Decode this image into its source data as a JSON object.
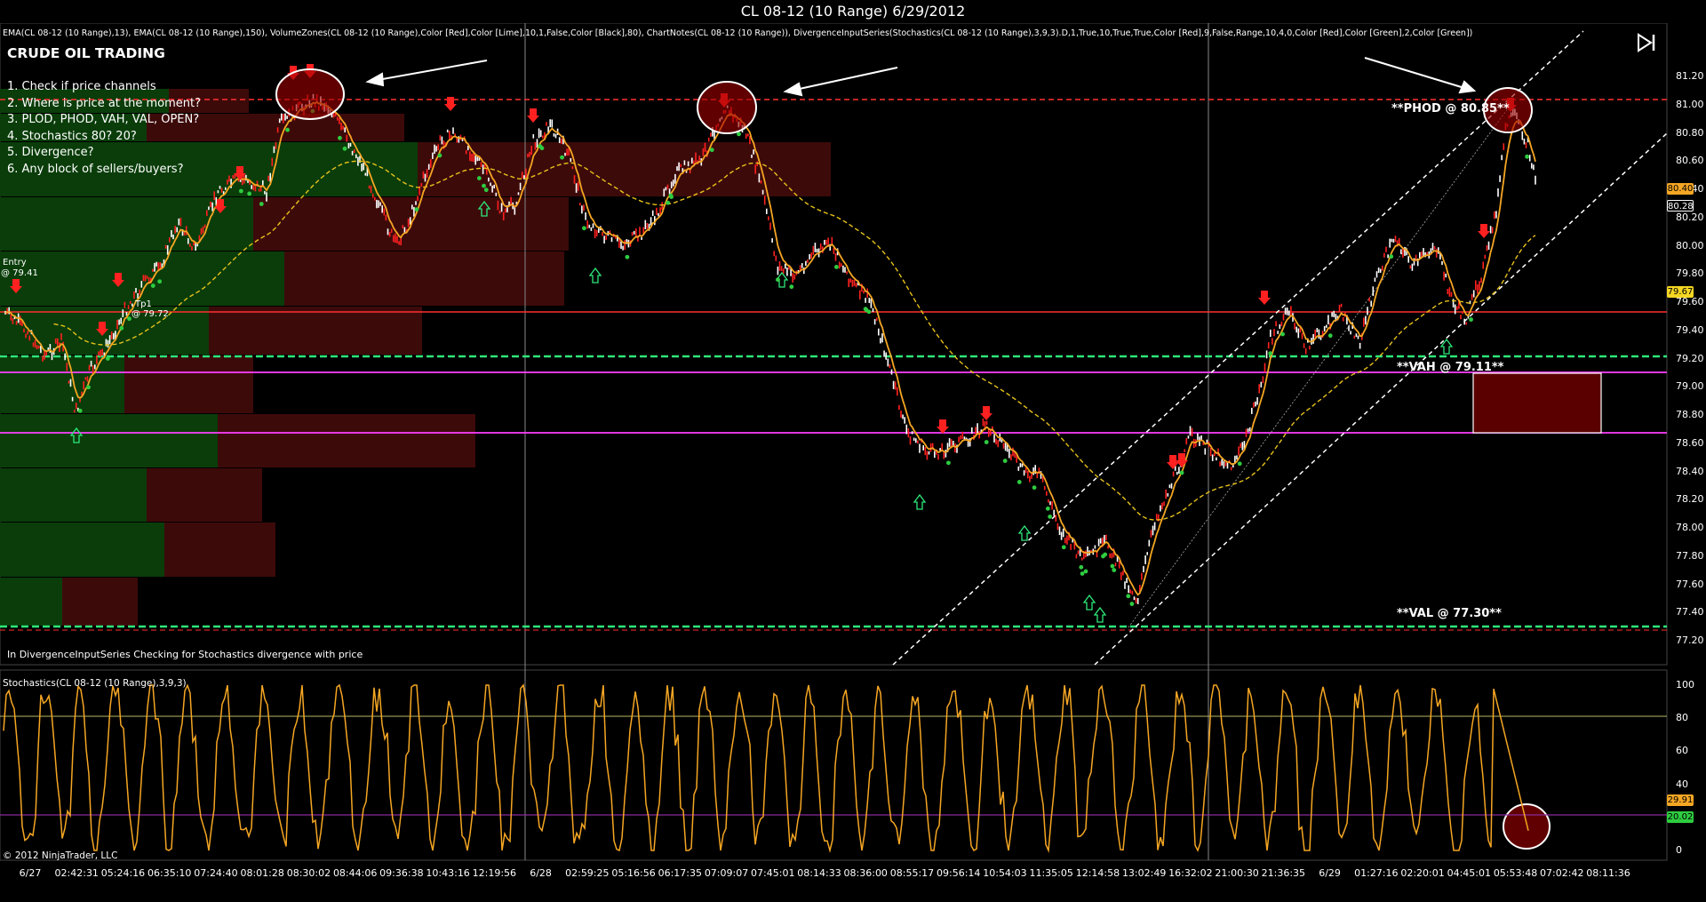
{
  "window": {
    "title": "CL 08-12 (10 Range)  6/29/2012"
  },
  "indicators_text": "EMA(CL 08-12 (10 Range),13), EMA(CL 08-12 (10 Range),150), VolumeZones(CL 08-12 (10 Range),Color [Red],Color [Lime],10,1,False,Color [Black],80), ChartNotes(CL 08-12 (10 Range)), DivergenceInputSeries(Stochastics(CL 08-12 (10 Range),3,9,3).D,1,True,10,True,True,Color [Red],9,False,Range,10,4,0,Color [Red],Color [Green],2,Color [Green])",
  "notes": {
    "title": "CRUDE OIL TRADING",
    "items": [
      "1. Check if price channels",
      "2. Where is price at the moment?",
      "3. PLOD, PHOD, VAH, VAL, OPEN?",
      "4. Stochastics 80? 20?",
      "5. Divergence?",
      "6. Any block of sellers/buyers?"
    ],
    "divergence_note": "In DivergenceInputSeries Checking for Stochastics  divergence with price"
  },
  "annotations": {
    "phod": "**PHOD @ 80.85**",
    "vah": "**VAH @ 79.11**",
    "val": "**VAL @ 77.30**",
    "entry_line1": "Entry",
    "entry_line2": "@ 79.41",
    "tp1": "Tp1",
    "tp1_price": "@ 79.72"
  },
  "stochastics_label": "Stochastics(CL 08-12 (10 Range),3,9,3)",
  "copyright": "© 2012 NinjaTrader, LLC",
  "price_axis": {
    "ticks": [
      "81.20",
      "81.00",
      "80.80",
      "80.60",
      "80.40",
      "80.20",
      "80.00",
      "79.80",
      "79.60",
      "79.40",
      "79.20",
      "79.00",
      "78.80",
      "78.60",
      "78.40",
      "78.20",
      "78.00",
      "77.80",
      "77.60",
      "77.40",
      "77.20"
    ],
    "tags": [
      {
        "value": "80.40",
        "color": "#f5a623",
        "text_color": "#000"
      },
      {
        "value": "80.28",
        "color": "#000",
        "text_color": "#fff"
      },
      {
        "value": "79.67",
        "color": "#f5d623",
        "text_color": "#000"
      }
    ]
  },
  "stoch_axis": {
    "ticks": [
      "100",
      "80",
      "60",
      "40",
      "20",
      "0"
    ],
    "tags": [
      {
        "value": "29.91",
        "color": "#f5a623",
        "text_color": "#000"
      },
      {
        "value": "20.02",
        "color": "#2ecc40",
        "text_color": "#000"
      }
    ]
  },
  "time_axis": {
    "ticks": [
      "6/27",
      "02:42:31",
      "05:24:16",
      "06:35:10",
      "07:24:40",
      "08:01:28",
      "08:30:02",
      "08:44:06",
      "09:36:38",
      "10:43:16",
      "12:19:56",
      "6/28",
      "02:59:25",
      "05:16:56",
      "06:17:35",
      "07:09:07",
      "07:45:01",
      "08:14:33",
      "08:36:00",
      "08:55:17",
      "09:56:14",
      "10:54:03",
      "11:35:05",
      "12:14:58",
      "13:02:49",
      "16:32:02",
      "21:00:30",
      "21:36:35",
      "6/29",
      "01:27:16",
      "02:20:01",
      "04:45:01",
      "05:53:48",
      "07:02:42",
      "08:11:36"
    ]
  },
  "colors": {
    "candle_up": "#ffffff",
    "candle_down": "#ff2020",
    "ema_fast": "#f5a623",
    "ema_slow": "#e8c21a",
    "stoch": "#f5a623",
    "vah_val_lines": "#ff40ff",
    "green_dashed": "#2ee87a",
    "red_dashed": "#ff3030",
    "volume_buy": "#0a3d0a",
    "volume_sell": "#3d0a0a"
  },
  "icons": {
    "jump_to_end": "jump-to-end-icon"
  }
}
